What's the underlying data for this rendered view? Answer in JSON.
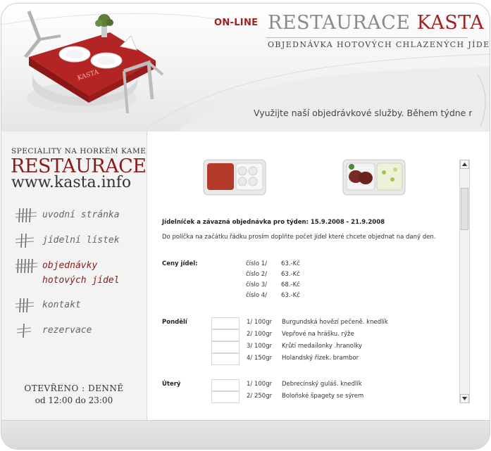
{
  "header": {
    "online": "ON-LINE",
    "brand_main": "RESTAURACE",
    "brand_accent": "KASTA",
    "brand_sub": "OBJEDNÁVKA HOTOVÝCH CHLAZENÝCH JÍDEL",
    "ticker": "Využijte naší objedrávkové služby. Během týdne mů:"
  },
  "logo": {
    "top": "SPECIALITY NA HORKÉM KAMENI",
    "main": "RESTAURACE",
    "url": "www.kasta.info"
  },
  "nav": {
    "items": [
      {
        "label": "uvodní stránka",
        "icon": "four-tally-icon"
      },
      {
        "label": "jídelní lístek",
        "icon": "three-tally-icon"
      },
      {
        "label": "objednávky",
        "label2": "hotových jídel",
        "icon": "five-tally-icon"
      },
      {
        "label": "kontakt",
        "icon": "four-tally-icon"
      },
      {
        "label": "rezervace",
        "icon": "two-tally-icon"
      }
    ]
  },
  "hours": {
    "line1": "OTEVŘENO : DENNĚ",
    "line2": "od 12:00 do 23:00"
  },
  "content": {
    "title": "Jídelníček a závazná objednávka pro týden: 15.9.2008 - 21.9.2008",
    "description": "Do políčka na začátku řádku prosím doplňte počet jídel které chcete objednat na daný den.",
    "prices_label": "Ceny jídel:",
    "prices": [
      {
        "num": "číslo 1/",
        "price": "63.-Kč"
      },
      {
        "num": "číslo 2/",
        "price": "63.-Kč"
      },
      {
        "num": "číslo 3/",
        "price": "68.-Kč"
      },
      {
        "num": "číslo 4/",
        "price": "63.-Kč"
      }
    ],
    "days": [
      {
        "name": "Pondělí",
        "items": [
          {
            "portion": "1/ 100gr",
            "dish": "Burgundská hovězí pečeně. knedlík"
          },
          {
            "portion": "2/ 100gr",
            "dish": "Vepřové na hrášku. rýže"
          },
          {
            "portion": "3/ 100gr",
            "dish": "Krůtí medailonky .hranolky"
          },
          {
            "portion": "4/ 150gr",
            "dish": "Holandský řízek. brambor"
          }
        ]
      },
      {
        "name": "Úterý",
        "items": [
          {
            "portion": "1/ 100gr",
            "dish": "Debrecínský guláš. knedlík"
          },
          {
            "portion": "2/ 250gr",
            "dish": "Boloňské špagety se sýrem"
          }
        ]
      }
    ]
  },
  "colors": {
    "accent": "#a32020",
    "logo_red": "#8b1a1a",
    "text": "#333333",
    "panel": "#f3f3f3"
  }
}
